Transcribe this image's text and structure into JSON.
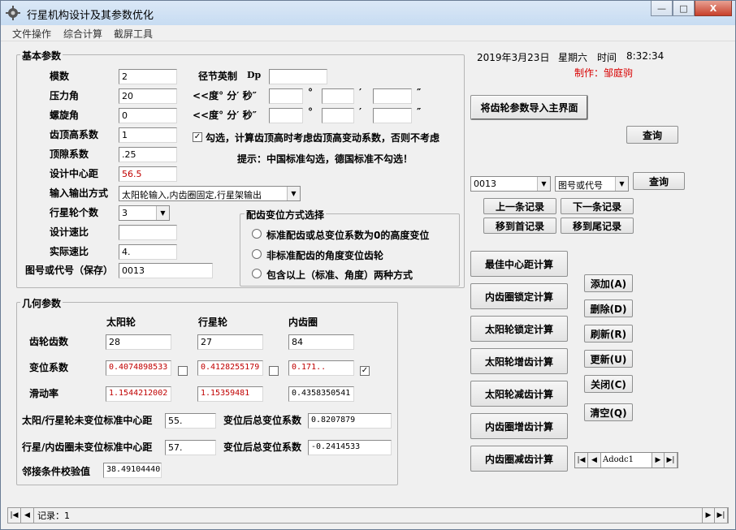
{
  "window": {
    "title": "行星机构设计及其参数优化",
    "controls": {
      "minimize": "—",
      "maximize": "□",
      "close": "X"
    }
  },
  "menu": [
    "文件操作",
    "综合计算",
    "截屏工具"
  ],
  "basic": {
    "title": "基本参数",
    "module": {
      "label": "模数",
      "value": "2"
    },
    "pressure_angle": {
      "label": "压力角",
      "value": "20"
    },
    "helix_angle": {
      "label": "螺旋角",
      "value": "0"
    },
    "addendum_coef": {
      "label": "齿顶高系数",
      "value": "1"
    },
    "clearance_coef": {
      "label": "顶隙系数",
      "value": ".25"
    },
    "design_center": {
      "label": "设计中心距",
      "value": "56.5"
    },
    "io_mode": {
      "label": "输入输出方式",
      "value": "太阳轮输入,内齿圈固定,行星架输出"
    },
    "planet_count": {
      "label": "行星轮个数",
      "value": "3"
    },
    "design_ratio": {
      "label": "设计速比",
      "value": ""
    },
    "actual_ratio": {
      "label": "实际速比",
      "value": "4."
    },
    "drawing_no": {
      "label": "图号或代号（保存）",
      "value": "0013"
    },
    "dp": {
      "label": "径节英制",
      "unit": "Dp",
      "value": ""
    },
    "dms1": {
      "label": "<<度° 分′ 秒″",
      "deg": "°",
      "min": "′",
      "sec": "″"
    },
    "dms2": {
      "label": "<<度° 分′ 秒″",
      "deg": "°",
      "min": "′",
      "sec": "″"
    },
    "checkbox_label": "勾选，计算齿顶高时考虑齿顶高变动系数，否则不考虑",
    "hint": "提示：中国标准勾选，德国标准不勾选！"
  },
  "shift": {
    "title": "配齿变位方式选择",
    "options": [
      "标准配齿或总变位系数为0的高度变位",
      "非标准配齿的角度变位齿轮",
      "包含以上（标准、角度）两种方式"
    ]
  },
  "geometry": {
    "title": "几何参数",
    "columns": [
      "太阳轮",
      "行星轮",
      "内齿圈"
    ],
    "teeth": {
      "label": "齿轮齿数",
      "values": [
        "28",
        "27",
        "84"
      ]
    },
    "shift_coef": {
      "label": "变位系数",
      "values": [
        "0.4074898533",
        "0.4128255179",
        "0.171.."
      ]
    },
    "slide_rate": {
      "label": "滑动率",
      "values": [
        "1.1544212002",
        "1.15359481",
        "0.4358350541"
      ]
    },
    "sun_planet_center": {
      "label": "太阳/行星轮未变位标准中心距",
      "value": "55."
    },
    "total_shift1": {
      "label": "变位后总变位系数",
      "value": "0.8207879"
    },
    "planet_ring_center": {
      "label": "行星/内齿圈未变位标准中心距",
      "value": "57."
    },
    "total_shift2": {
      "label": "变位后总变位系数",
      "value": "-0.2414533"
    },
    "adjacent": {
      "label": "邻接条件校验值",
      "value": "38.49104440"
    }
  },
  "right": {
    "date": "2019年3月23日",
    "weekday": "星期六",
    "time_label": "时间",
    "time": "8:32:34",
    "author": "制作：邹庭驹",
    "import_btn": "将齿轮参数导入主界面",
    "query_btn1": "查询",
    "record_select": "0013",
    "field_select": "图号或代号",
    "query_btn2": "查询",
    "prev": "上一条记录",
    "next": "下一条记录",
    "first": "移到首记录",
    "last": "移到尾记录",
    "calc_buttons": [
      "最佳中心距计算",
      "内齿圈锁定计算",
      "太阳轮锁定计算",
      "太阳轮增齿计算",
      "太阳轮减齿计算",
      "内齿圈增齿计算",
      "内齿圈减齿计算"
    ],
    "edit_buttons": [
      "添加(A)",
      "删除(D)",
      "刷新(R)",
      "更新(U)",
      "关闭(C)",
      "清空(Q)"
    ],
    "adodc": "Adodc1"
  },
  "status": {
    "record": "记录：1"
  }
}
